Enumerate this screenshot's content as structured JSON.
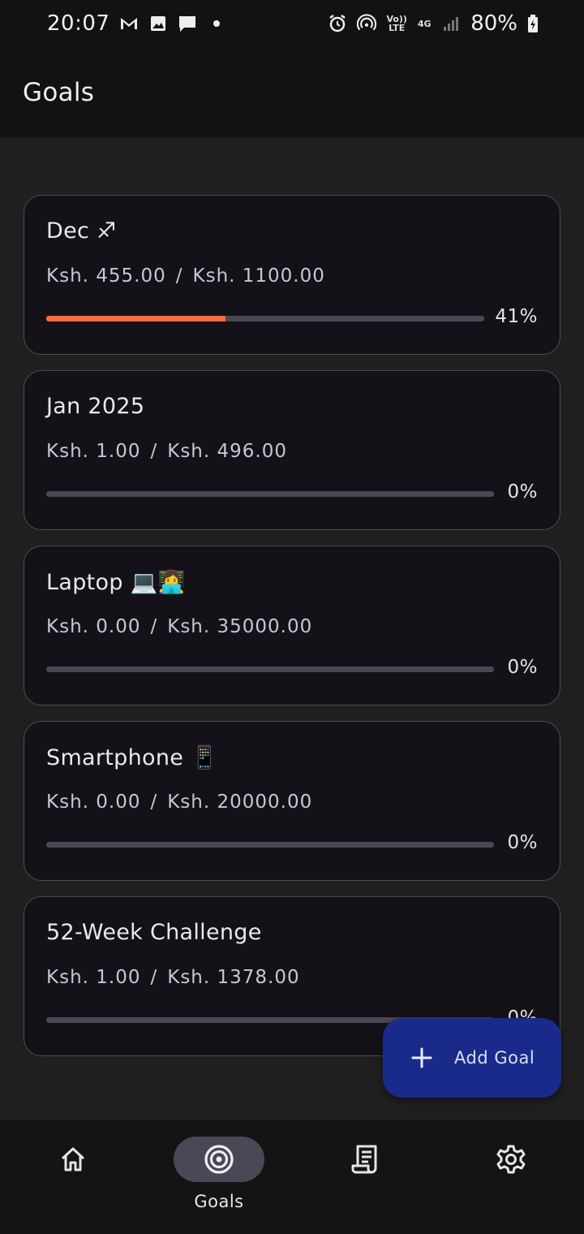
{
  "status_bar": {
    "time": "20:07",
    "battery": "80%",
    "network_top": "Vo)) LTE",
    "network_4g": "4G",
    "left_icons": [
      "gmail-icon",
      "gallery-icon",
      "message-icon",
      "dot-icon"
    ],
    "right_icons": [
      "alarm-icon",
      "hotspot-icon",
      "volte-icon",
      "4g-icon",
      "signal-icon",
      "battery-icon"
    ]
  },
  "app_bar": {
    "title": "Goals"
  },
  "goals": [
    {
      "name": "Dec ♐",
      "saved": "Ksh. 455.00",
      "target": "Ksh. 1100.00",
      "separator": "/",
      "percent_label": "41%",
      "progress": 0.41
    },
    {
      "name": "Jan 2025",
      "saved": "Ksh. 1.00",
      "target": "Ksh. 496.00",
      "separator": "/",
      "percent_label": "0%",
      "progress": 0
    },
    {
      "name": "Laptop 💻👩‍💻",
      "saved": "Ksh. 0.00",
      "target": "Ksh. 35000.00",
      "separator": "/",
      "percent_label": "0%",
      "progress": 0
    },
    {
      "name": "Smartphone 📱",
      "saved": "Ksh. 0.00",
      "target": "Ksh. 20000.00",
      "separator": "/",
      "percent_label": "0%",
      "progress": 0
    },
    {
      "name": "52-Week Challenge",
      "saved": "Ksh. 1.00",
      "target": "Ksh. 1378.00",
      "separator": "/",
      "percent_label": "0%",
      "progress": 0
    }
  ],
  "fab": {
    "label": "Add Goal",
    "icon": "plus-icon"
  },
  "bottom_nav": {
    "items": [
      {
        "icon": "home-icon",
        "label": "",
        "active": false
      },
      {
        "icon": "target-icon",
        "label": "Goals",
        "active": true
      },
      {
        "icon": "receipt-icon",
        "label": "",
        "active": false
      },
      {
        "icon": "gear-icon",
        "label": "",
        "active": false
      }
    ]
  },
  "colors": {
    "progress_fill": "#ff6a3d",
    "progress_track": "#4a4850",
    "fab_background": "#1a2a8a",
    "card_background": "#141218",
    "card_border": "#4d4a52",
    "active_nav_pill": "#4a4856"
  }
}
